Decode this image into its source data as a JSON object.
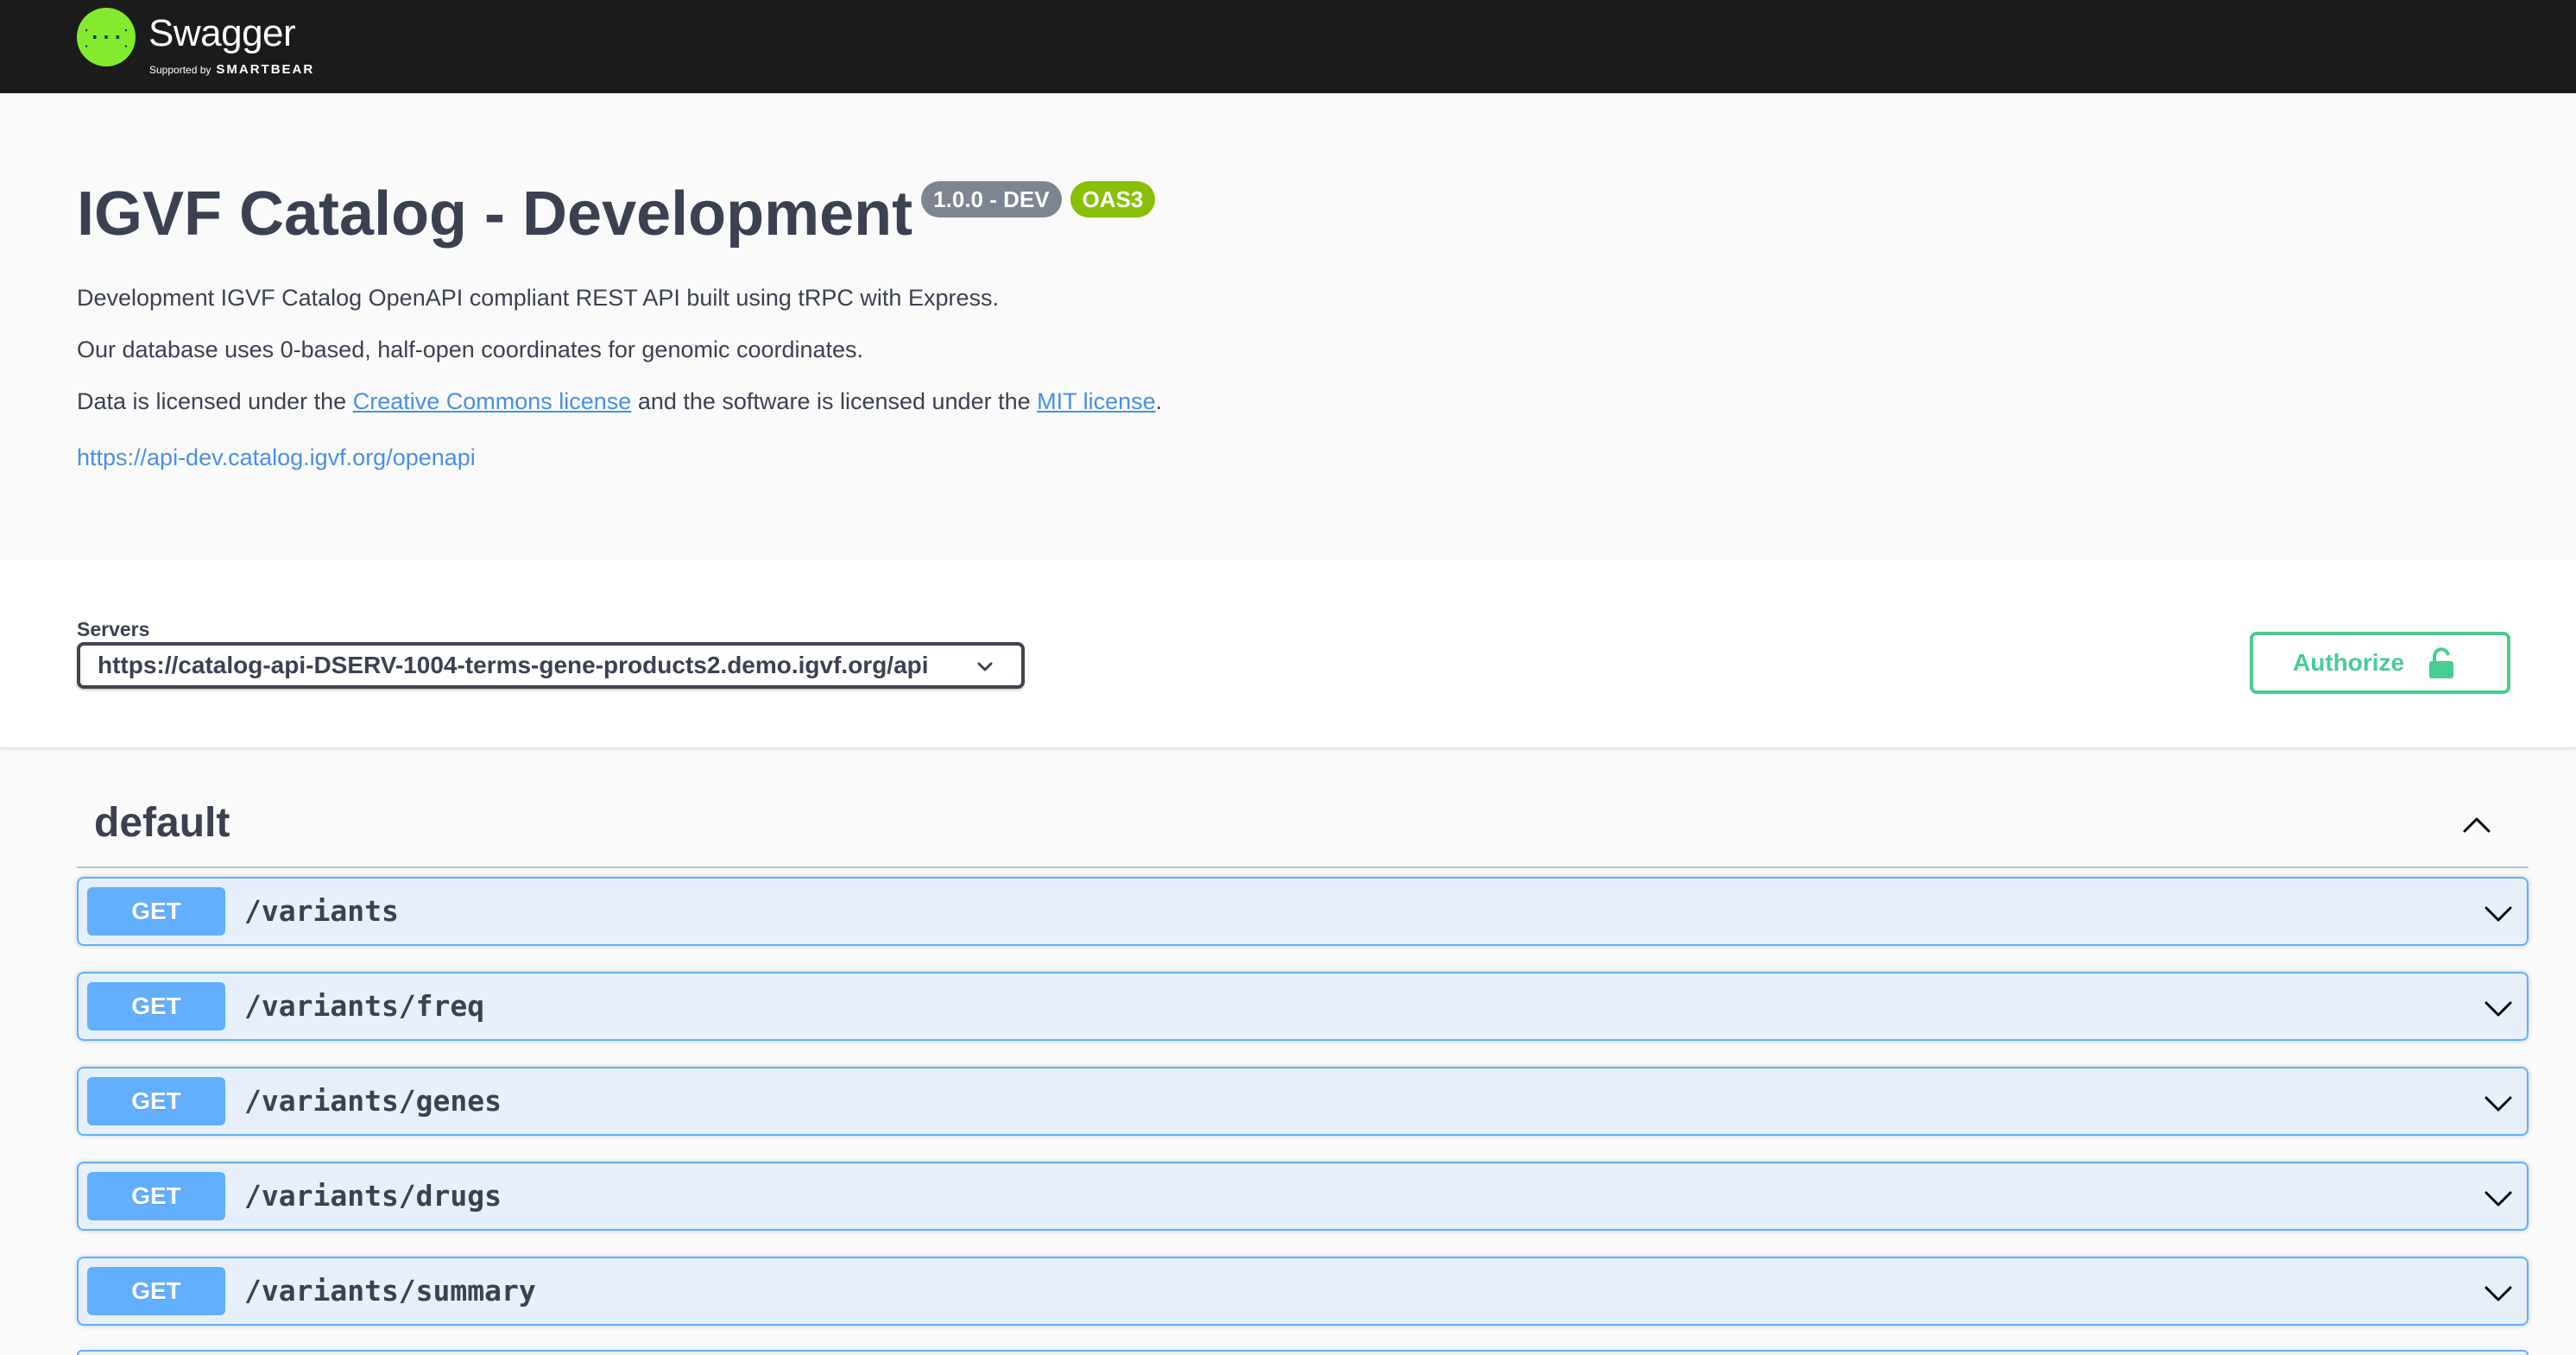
{
  "topbar": {
    "brand": "Swagger",
    "supported_by": "Supported by",
    "sponsor": "SMARTBEAR"
  },
  "info": {
    "title": "IGVF Catalog - Development",
    "version_badge": "1.0.0 - DEV",
    "oas_badge": "OAS3",
    "desc_line1": "Development IGVF Catalog OpenAPI compliant REST API built using tRPC with Express.",
    "desc_line2": "Our database uses 0-based, half-open coordinates for genomic coordinates.",
    "desc_line3_a": "Data is licensed under the ",
    "desc_line3_link1": "Creative Commons license",
    "desc_line3_b": " and the software is licensed under the ",
    "desc_line3_link2": "MIT license",
    "desc_line3_c": ".",
    "spec_link": "https://api-dev.catalog.igvf.org/openapi"
  },
  "servers": {
    "label": "Servers",
    "selected": "https://catalog-api-DSERV-1004-terms-gene-products2.demo.igvf.org/api"
  },
  "authorize": {
    "label": "Authorize"
  },
  "tag": {
    "name": "default"
  },
  "operations": [
    {
      "method": "GET",
      "path": "/variants"
    },
    {
      "method": "GET",
      "path": "/variants/freq"
    },
    {
      "method": "GET",
      "path": "/variants/genes"
    },
    {
      "method": "GET",
      "path": "/variants/drugs"
    },
    {
      "method": "GET",
      "path": "/variants/summary"
    }
  ],
  "colors": {
    "topbar": "#1b1b1b",
    "logo_green": "#85ea2d",
    "get_blue": "#61affe",
    "authorize_green": "#49cc90",
    "version_badge": "#7d8492",
    "oas_badge": "#89bf04",
    "link": "#4990e2"
  },
  "icons": {
    "logo": "swagger-logo-icon",
    "dropdown": "chevron-down-icon",
    "lock": "unlock-icon",
    "collapse": "chevron-up-icon",
    "expand": "chevron-down-icon"
  }
}
